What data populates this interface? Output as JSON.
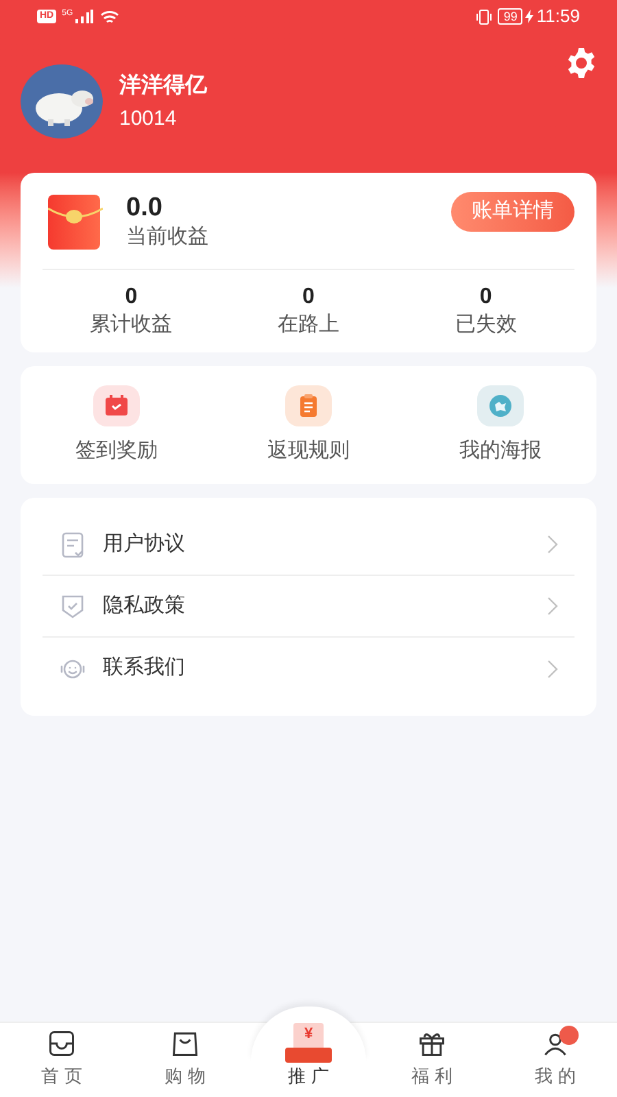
{
  "status_bar": {
    "network_badge": "HD",
    "network_type": "5G",
    "battery": "99",
    "time": "11:59"
  },
  "profile": {
    "name": "洋洋得亿",
    "id": "10014"
  },
  "earnings": {
    "amount": "0.0",
    "label": "当前收益",
    "button": "账单详情",
    "stats": [
      {
        "value": "0",
        "label": "累计收益"
      },
      {
        "value": "0",
        "label": "在路上"
      },
      {
        "value": "0",
        "label": "已失效"
      }
    ]
  },
  "shortcuts": [
    {
      "kind": "calendar",
      "label": "签到奖励"
    },
    {
      "kind": "clipboard",
      "label": "返现规则"
    },
    {
      "kind": "poster",
      "label": "我的海报"
    }
  ],
  "menu": [
    {
      "kind": "document",
      "label": "用户协议"
    },
    {
      "kind": "shield",
      "label": "隐私政策"
    },
    {
      "kind": "headset",
      "label": "联系我们"
    }
  ],
  "bottom_nav": [
    {
      "kind": "home",
      "label": "首 页",
      "selected": false
    },
    {
      "kind": "bag",
      "label": "购 物",
      "selected": false
    },
    {
      "kind": "promote",
      "label": "推 广",
      "icon_text": "¥",
      "selected": true
    },
    {
      "kind": "gift",
      "label": "福 利",
      "selected": false
    },
    {
      "kind": "me",
      "label": "我 的",
      "selected": false
    }
  ]
}
